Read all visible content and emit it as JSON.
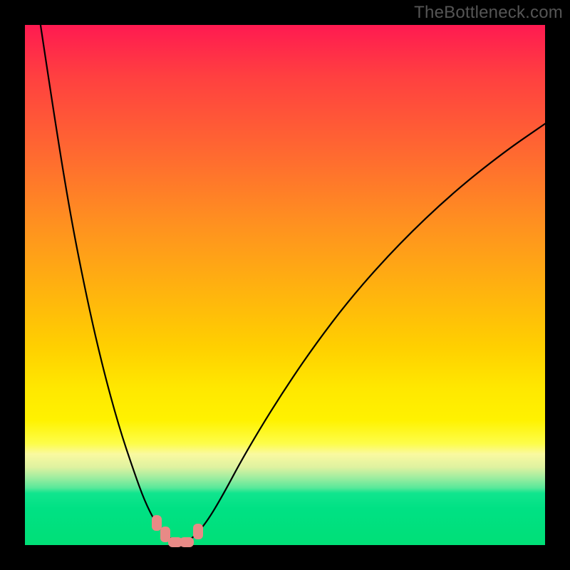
{
  "attribution": "TheBottleneck.com",
  "chart_data": {
    "type": "line",
    "title": "",
    "xlabel": "",
    "ylabel": "",
    "xlim": [
      0,
      100
    ],
    "ylim": [
      0,
      100
    ],
    "grid": false,
    "series": [
      {
        "name": "left-branch",
        "x": [
          3,
          6,
          9,
          12,
          15,
          18,
          21,
          23,
          25,
          26.5,
          27.5
        ],
        "y": [
          100,
          80,
          62,
          47,
          34,
          23,
          14,
          8.5,
          4.5,
          2.6,
          1.6
        ]
      },
      {
        "name": "trough",
        "x": [
          27.5,
          28.5,
          29.5,
          30.5,
          31.5,
          32.5
        ],
        "y": [
          1.6,
          1.0,
          0.75,
          0.75,
          1.0,
          1.6
        ]
      },
      {
        "name": "right-branch",
        "x": [
          32.5,
          35,
          38,
          42,
          48,
          55,
          63,
          72,
          82,
          92,
          100
        ],
        "y": [
          1.6,
          4.5,
          9.5,
          17,
          27,
          37.5,
          48,
          58,
          67.5,
          75.5,
          81
        ]
      }
    ],
    "markers": [
      {
        "name": "bead-left-upper",
        "x": 25.3,
        "y": 4.2
      },
      {
        "name": "bead-left-lower",
        "x": 27.0,
        "y": 2.0
      },
      {
        "name": "bead-bottom-left",
        "x": 28.9,
        "y": 0.6
      },
      {
        "name": "bead-bottom-right",
        "x": 31.1,
        "y": 0.6
      },
      {
        "name": "bead-right",
        "x": 33.3,
        "y": 2.6
      }
    ],
    "marker_color": "#e88a86"
  }
}
